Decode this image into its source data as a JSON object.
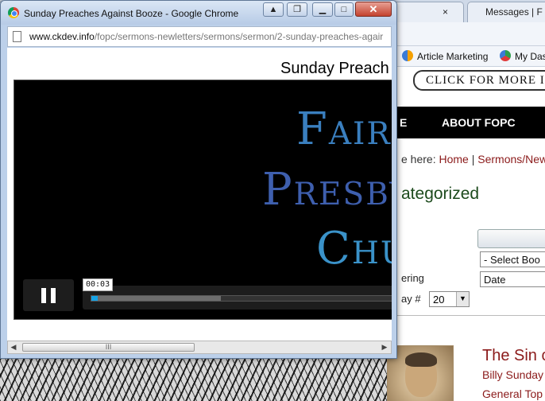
{
  "popup": {
    "window_title": "Sunday Preaches Against Booze - Google Chrome",
    "close_glyph": "✕",
    "address": {
      "domain": "www.ckdev.info",
      "path": "/fopc/sermons-newletters/sermons/sermon/2-sunday-preaches-agair"
    },
    "page_heading": "Sunday Preach",
    "video": {
      "logo_lines": [
        "Fair",
        "Presby",
        "Chu"
      ],
      "time_tooltip": "00:03",
      "progress_played": 0.02,
      "progress_buffered": 0.43,
      "state": "playing"
    },
    "scroll_thumb_glyph": "III"
  },
  "background": {
    "tabs": [
      {
        "label": ""
      },
      {
        "label": "Messages | F"
      }
    ],
    "tab_close_glyph": "×",
    "bookmarks": [
      {
        "label": "Article Marketing",
        "icon": "globe-icon"
      },
      {
        "label": "My Das",
        "icon": "globe-icon"
      }
    ],
    "site": {
      "banner": "CLICK FOR MORE I",
      "nav_items": [
        "E",
        "ABOUT FOPC"
      ],
      "breadcrumb": {
        "prefix": "e here:",
        "home": "Home",
        "sep": "|",
        "current": "Sermons/Newle"
      },
      "category_heading": "ategorized",
      "filters": {
        "book_value": "- Select Boo",
        "ordering_label": "ering",
        "ordering_value": "Date",
        "display_label": "ay #",
        "display_value": "20"
      },
      "sermon": {
        "title": "The Sin c",
        "author": "Billy Sunday",
        "topic": "General Top"
      }
    }
  },
  "colors": {
    "link": "#8b1a1a",
    "category_heading": "#1c4a1c",
    "seek_played": "#16a3e6"
  }
}
